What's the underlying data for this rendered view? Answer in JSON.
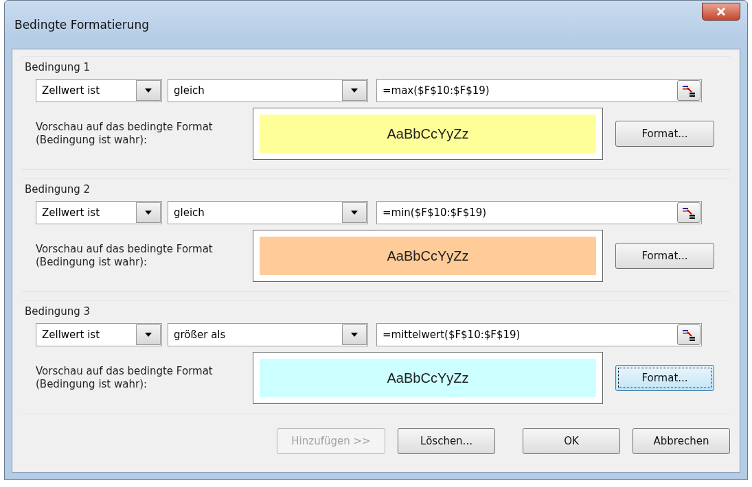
{
  "window": {
    "title": "Bedingte Formatierung"
  },
  "conditions": [
    {
      "heading": "Bedingung 1",
      "type": "Zellwert ist",
      "operator": "gleich",
      "formula": "=max($F$10:$F$19)",
      "preview_label": "Vorschau auf das bedingte Format (Bedingung ist wahr):",
      "preview_text": "AaBbCcYyZz",
      "color": "#ffff99",
      "format_button": {
        "label": "Format...",
        "focused": false
      }
    },
    {
      "heading": "Bedingung 2",
      "type": "Zellwert ist",
      "operator": "gleich",
      "formula": "=min($F$10:$F$19)",
      "preview_label": "Vorschau auf das bedingte Format (Bedingung ist wahr):",
      "preview_text": "AaBbCcYyZz",
      "color": "#ffcc99",
      "format_button": {
        "label": "Format...",
        "focused": false
      }
    },
    {
      "heading": "Bedingung 3",
      "type": "Zellwert ist",
      "operator": "größer als",
      "formula": "=mittelwert($F$10:$F$19)",
      "preview_label": "Vorschau auf das bedingte Format (Bedingung ist wahr):",
      "preview_text": "AaBbCcYyZz",
      "color": "#ccffff",
      "format_button": {
        "label": "Format...",
        "focused": true
      }
    }
  ],
  "buttons": [
    {
      "label": "Hinzufügen >>",
      "disabled": true
    },
    {
      "label": "Löschen...",
      "disabled": false
    },
    {
      "label": "OK",
      "disabled": false
    },
    {
      "label": "Abbrechen",
      "disabled": false
    }
  ]
}
